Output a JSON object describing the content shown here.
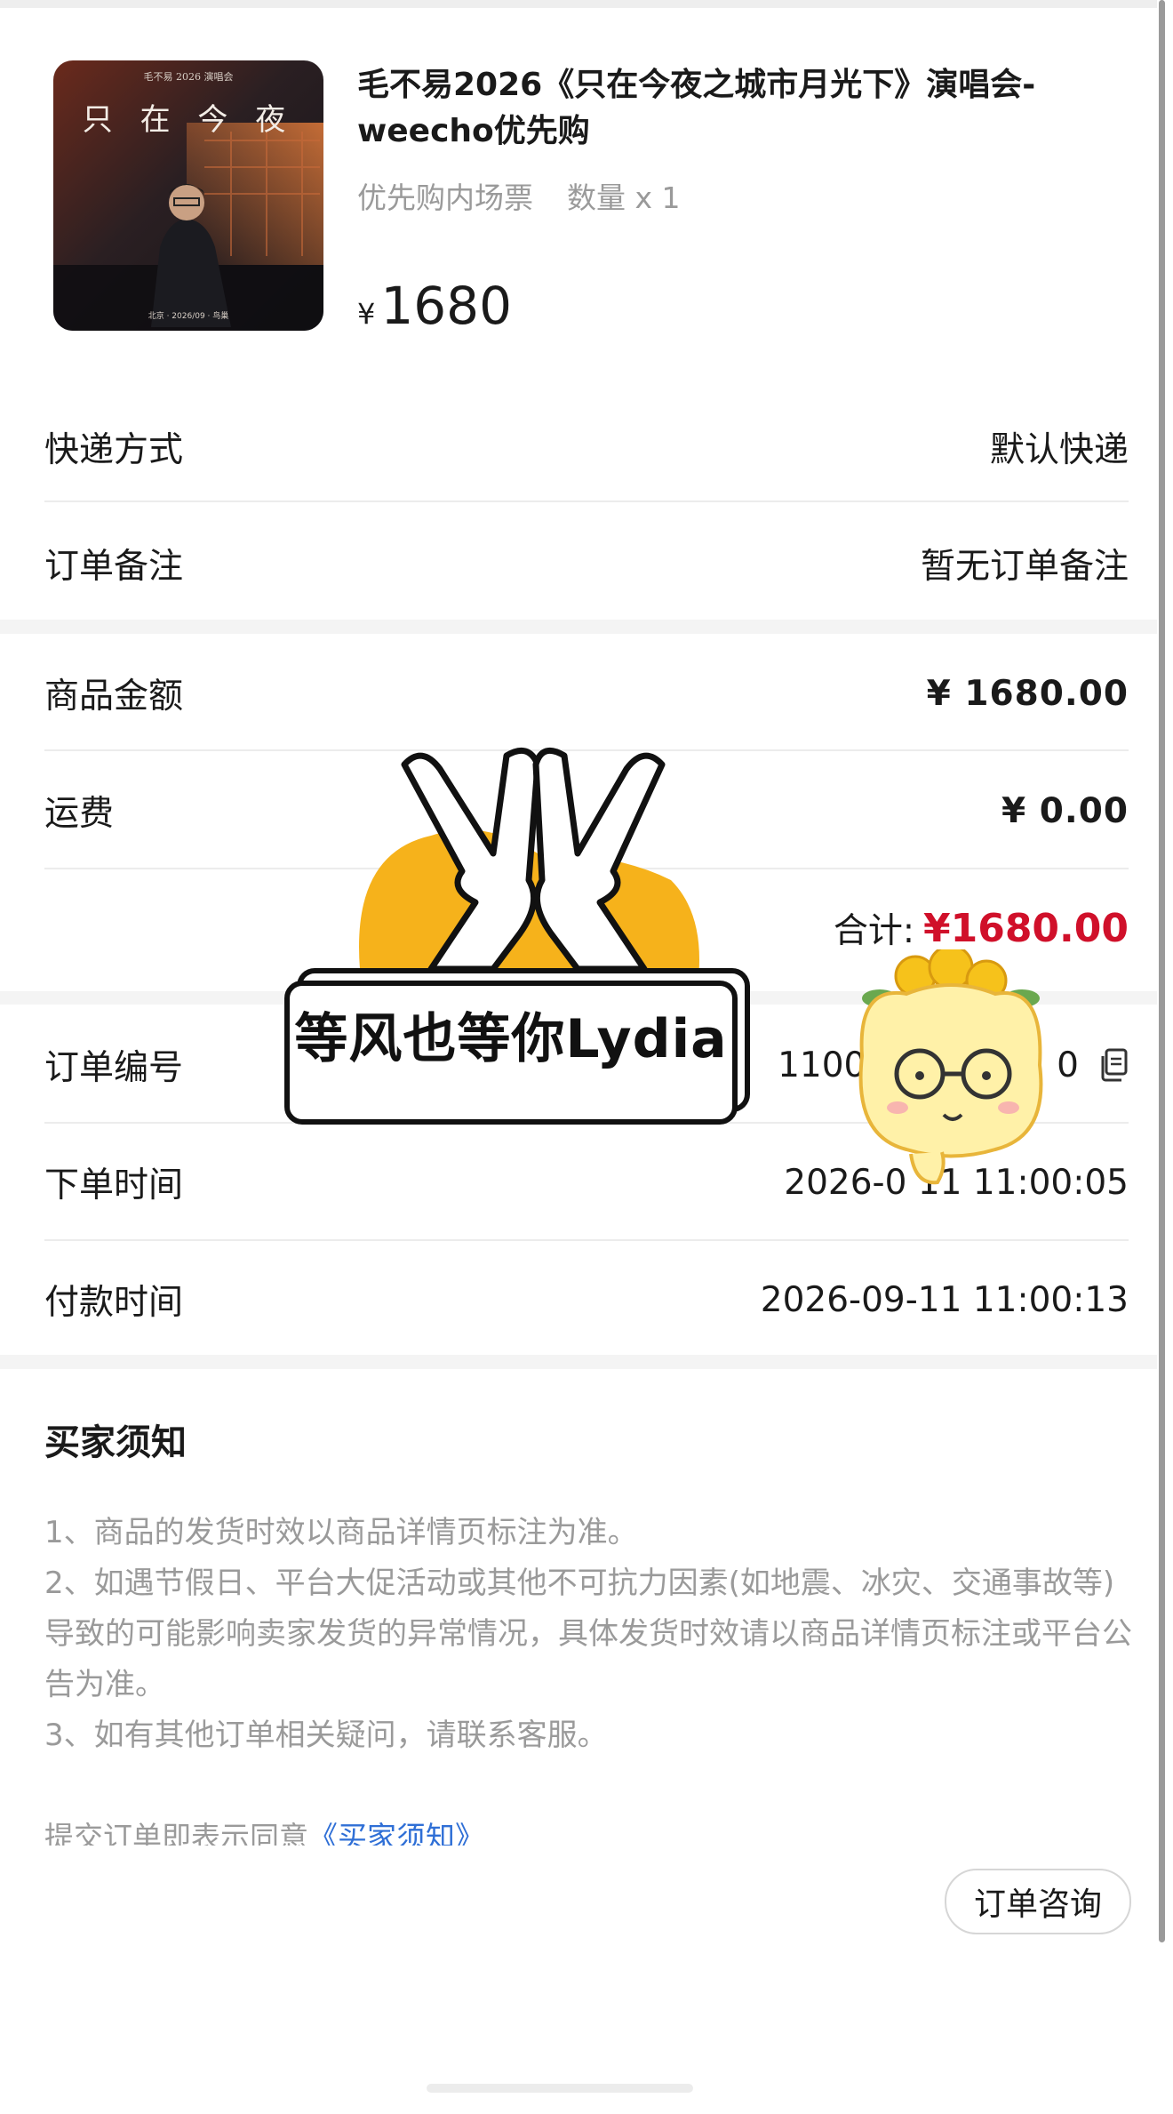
{
  "product": {
    "title": "毛不易2026《只在今夜之城市月光下》演唱会-weecho优先购",
    "ticket_type": "优先购内场票",
    "quantity": "数量 x 1",
    "currency": "¥",
    "price": "1680",
    "cover_text": "只 在 今 夜"
  },
  "shipping": {
    "label": "快递方式",
    "value": "默认快递"
  },
  "remark": {
    "label": "订单备注",
    "value": "暂无订单备注"
  },
  "amounts": {
    "goods_label": "商品金额",
    "goods_value": "¥ 1680.00",
    "freight_label": "运费",
    "freight_value": "¥ 0.00",
    "total_label": "合计:",
    "total_value": "¥1680.00"
  },
  "order": {
    "id_label": "订单编号",
    "id_value_visible_start": "11000",
    "id_value_visible_end": "0",
    "created_label": "下单时间",
    "created_value": "2026-0 11 11:00:05",
    "paid_label": "付款时间",
    "paid_value": "2026-09-11 11:00:13"
  },
  "notice": {
    "title": "买家须知",
    "items": [
      "1、商品的发货时效以商品详情页标注为准。",
      "2、如遇节假日、平台大促活动或其他不可抗力因素(如地震、冰灾、交通事故等)导致的可能影响卖家发货的异常情况，具体发货时效请以商品详情页标注或平台公告为准。",
      "3、如有其他订单相关疑问，请联系客服。"
    ],
    "agree_prefix": "提交订单即表示同意",
    "agree_link": "《买家须知》"
  },
  "actions": {
    "consult": "订单咨询"
  },
  "watermark": {
    "text": "等风也等你Lydia"
  },
  "colors": {
    "total_red": "#d0102a",
    "link_blue": "#2f6fd6",
    "muted": "#9a9a9a",
    "sticker_yellow": "#f6b21b"
  },
  "icons": {
    "copy": "copy-icon"
  }
}
